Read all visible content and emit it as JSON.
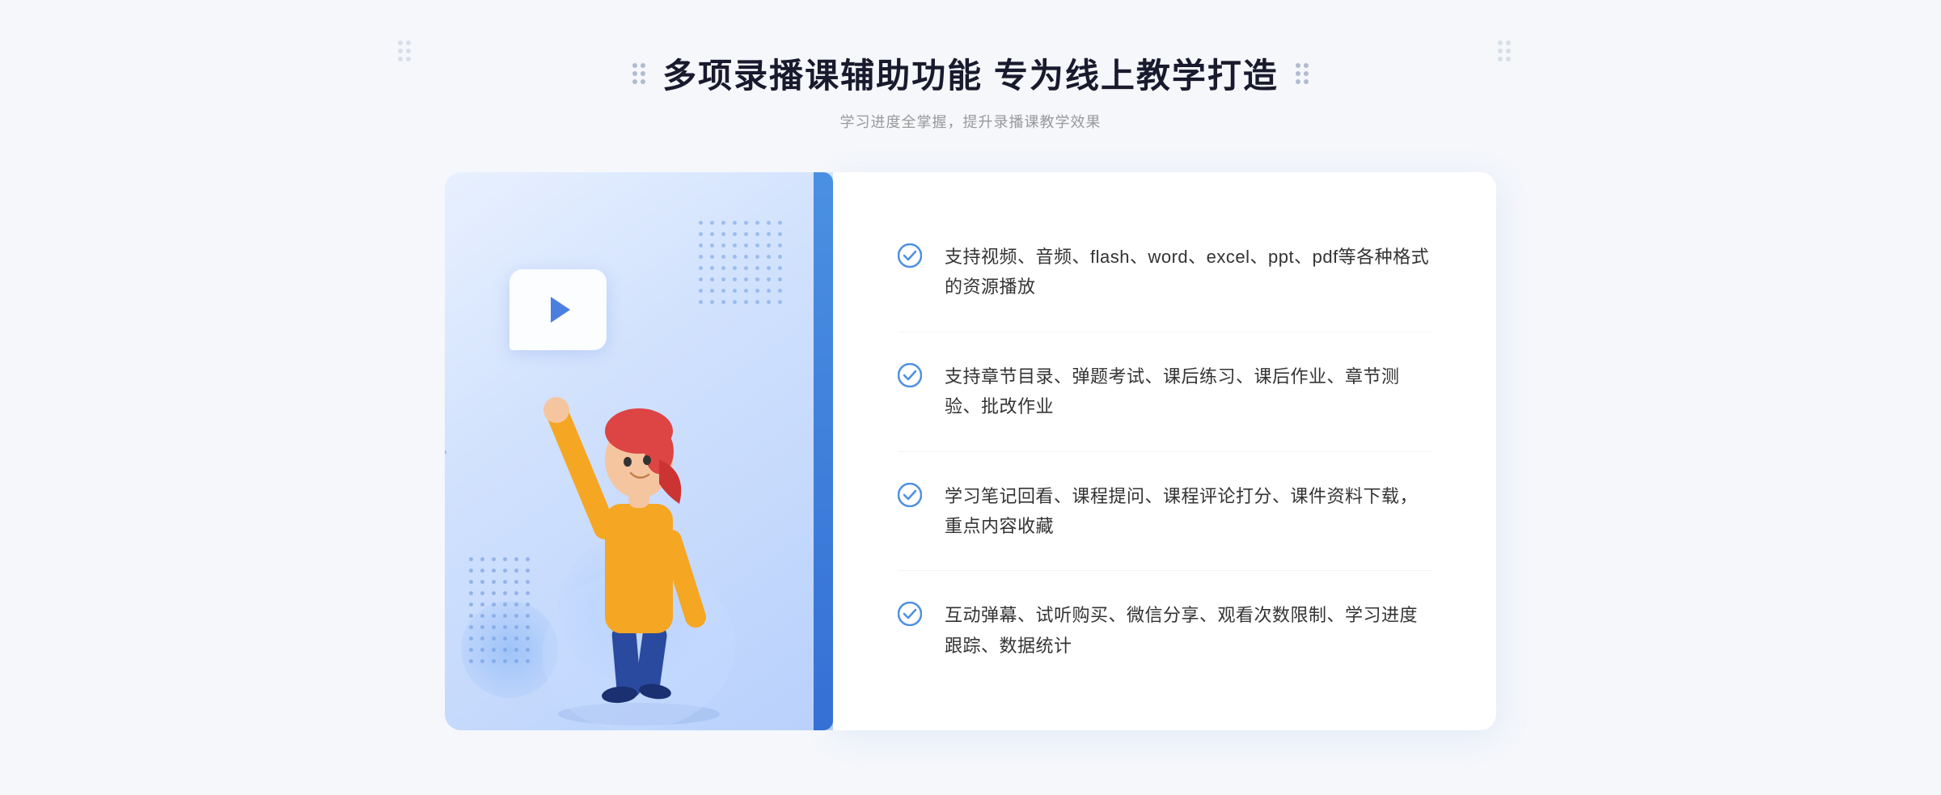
{
  "header": {
    "title": "多项录播课辅助功能 专为线上教学打造",
    "subtitle": "学习进度全掌握，提升录播课教学效果"
  },
  "features": [
    {
      "id": "feature-1",
      "text": "支持视频、音频、flash、word、excel、ppt、pdf等各种格式的资源播放"
    },
    {
      "id": "feature-2",
      "text": "支持章节目录、弹题考试、课后练习、课后作业、章节测验、批改作业"
    },
    {
      "id": "feature-3",
      "text": "学习笔记回看、课程提问、课程评论打分、课件资料下载，重点内容收藏"
    },
    {
      "id": "feature-4",
      "text": "互动弹幕、试听购买、微信分享、观看次数限制、学习进度跟踪、数据统计"
    }
  ],
  "check_icon_color": "#4a90e2",
  "accent_color": "#4a7fe0",
  "title_decorator_color": "#b0bcd0"
}
